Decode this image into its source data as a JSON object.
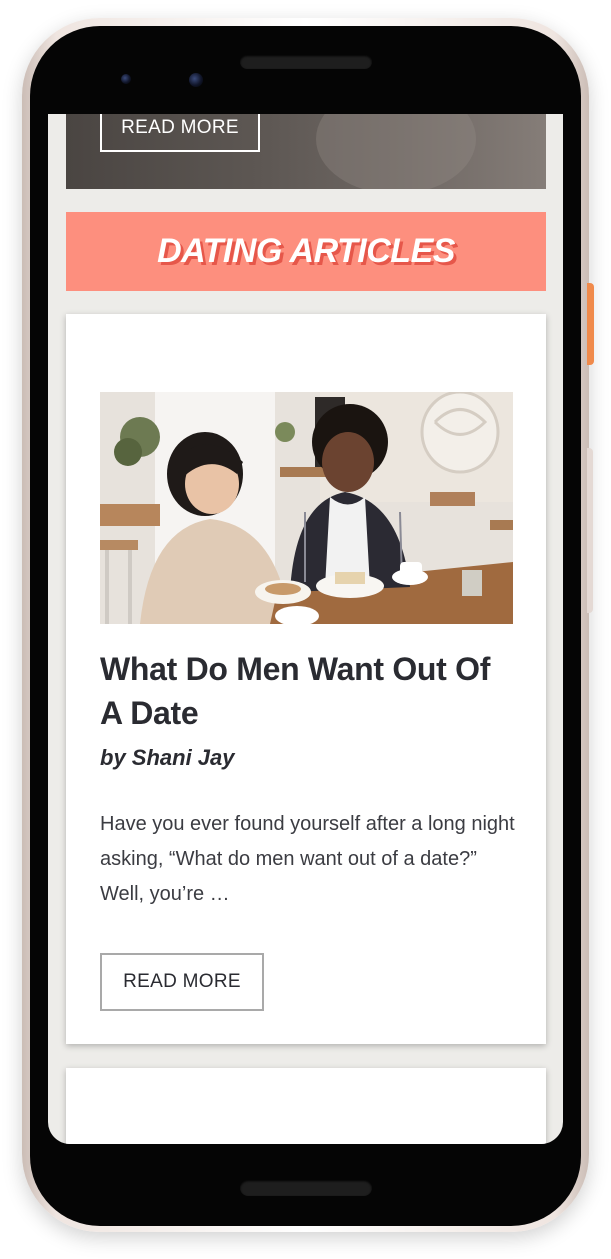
{
  "top_card": {
    "read_more_label": "READ MORE"
  },
  "section": {
    "title": "DATING ARTICLES",
    "banner_color": "#fd8f7e"
  },
  "article": {
    "image_alt": "Couple smiling at a cafe table",
    "title": "What Do Men Want Out Of A Date",
    "author": "by Shani Jay",
    "excerpt": "Have you ever found yourself after a long night asking, “What do men want out of a date?” Well, you’re …",
    "read_more_label": "READ MORE"
  }
}
